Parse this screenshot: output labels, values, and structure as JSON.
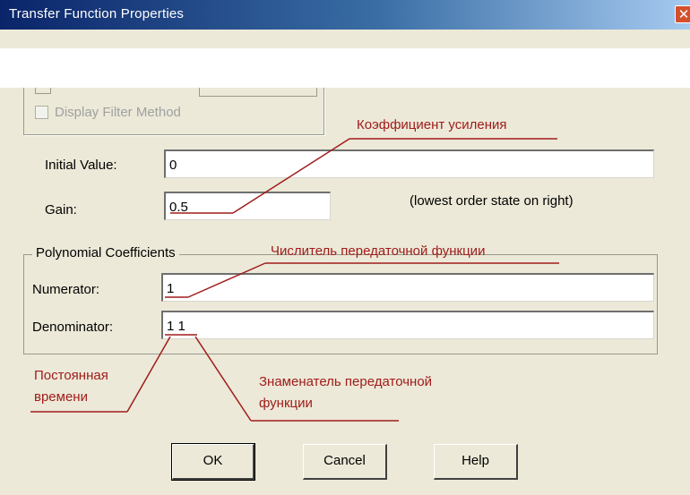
{
  "window": {
    "title": "Transfer Function Properties",
    "close_symbol": "✕"
  },
  "filter_group": {
    "display_filter_method_label": "Display Filter Method",
    "display_filter_method_checked": false
  },
  "fields": {
    "initial_value_label": "Initial Value:",
    "initial_value": "0",
    "gain_label": "Gain:",
    "gain_value": "0.5",
    "note": "(lowest order state on right)"
  },
  "polynomial": {
    "legend": "Polynomial Coefficients",
    "numerator_label": "Numerator:",
    "numerator_value": "1",
    "denominator_label": "Denominator:",
    "denominator_value": "1 1"
  },
  "buttons": {
    "ok": "OK",
    "cancel": "Cancel",
    "help": "Help"
  },
  "annotations": {
    "gain_coeff": "Коэффициент усиления",
    "numerator": "Числитель передаточной функции",
    "time_constant_line1": "Постоянная",
    "time_constant_line2": "времени",
    "denominator_line1": "Знаменатель передаточной",
    "denominator_line2": "функции",
    "color": "#a01c1c"
  }
}
